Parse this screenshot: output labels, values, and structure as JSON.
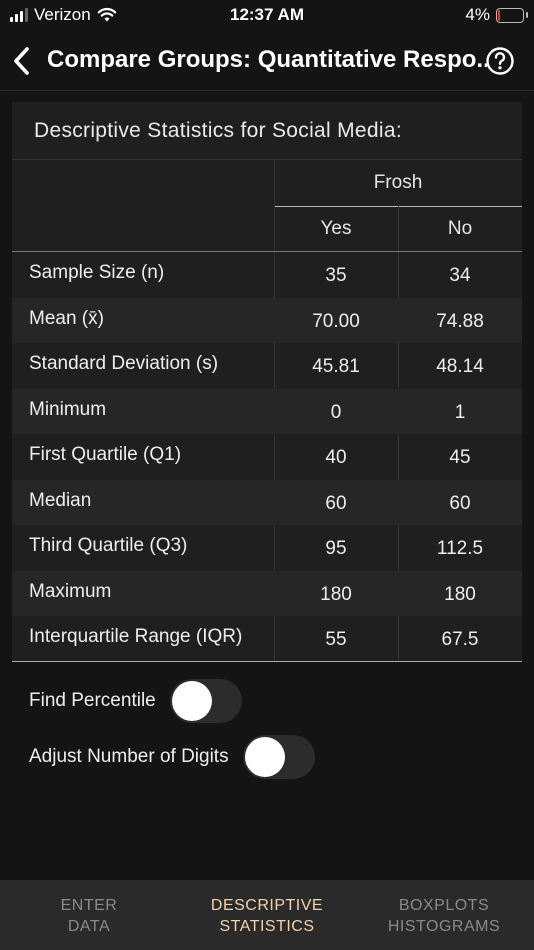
{
  "status_bar": {
    "carrier": "Verizon",
    "time": "12:37 AM",
    "battery": "4%"
  },
  "nav": {
    "title": "Compare Groups: Quantitative Respo..."
  },
  "stats": {
    "title": "Descriptive Statistics for Social Media:",
    "group_header": "Frosh",
    "columns": [
      "Yes",
      "No"
    ],
    "rows": [
      {
        "label": "Sample Size (n)",
        "yes": "35",
        "no": "34"
      },
      {
        "label": "Mean (x̄)",
        "yes": "70.00",
        "no": "74.88"
      },
      {
        "label": "Standard Deviation (s)",
        "yes": "45.81",
        "no": "48.14"
      },
      {
        "label": "Minimum",
        "yes": "0",
        "no": "1"
      },
      {
        "label": "First Quartile (Q1)",
        "yes": "40",
        "no": "45"
      },
      {
        "label": "Median",
        "yes": "60",
        "no": "60"
      },
      {
        "label": "Third Quartile (Q3)",
        "yes": "95",
        "no": "112.5"
      },
      {
        "label": "Maximum",
        "yes": "180",
        "no": "180"
      },
      {
        "label": "Interquartile Range (IQR)",
        "yes": "55",
        "no": "67.5"
      }
    ]
  },
  "options": {
    "find_percentile": {
      "label": "Find Percentile",
      "on": false
    },
    "adjust_digits": {
      "label": "Adjust Number of Digits",
      "on": false
    }
  },
  "tabs": [
    {
      "line1": "ENTER",
      "line2": "DATA",
      "active": false
    },
    {
      "line1": "DESCRIPTIVE",
      "line2": "STATISTICS",
      "active": true
    },
    {
      "line1": "BOXPLOTS",
      "line2": "HISTOGRAMS",
      "active": false
    }
  ],
  "colors": {
    "accent": "#f3d3a8",
    "background": "#141414",
    "card": "#1f1f1f"
  }
}
